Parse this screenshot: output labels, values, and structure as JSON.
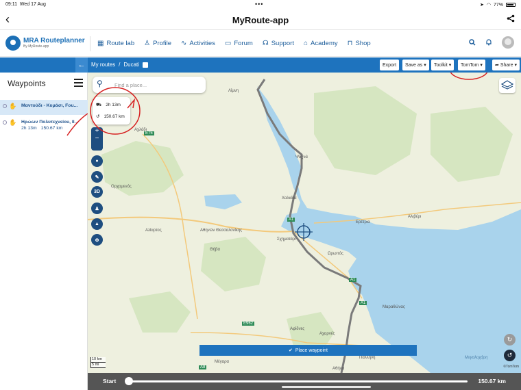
{
  "status_bar": {
    "time": "09:11",
    "date": "Wed 17 Aug",
    "battery": "77%"
  },
  "app": {
    "title": "MyRoute-app"
  },
  "site_nav": {
    "logo_title": "MRA Routeplanner",
    "logo_sub": "By MyRoute-app",
    "links": [
      {
        "label": "Route lab",
        "icon": "map-icon"
      },
      {
        "label": "Profile",
        "icon": "person-icon"
      },
      {
        "label": "Activities",
        "icon": "activity-icon"
      },
      {
        "label": "Forum",
        "icon": "chat-icon"
      },
      {
        "label": "Support",
        "icon": "headset-icon"
      },
      {
        "label": "Academy",
        "icon": "graduation-icon"
      },
      {
        "label": "Shop",
        "icon": "bag-icon"
      }
    ]
  },
  "toolbar": {
    "breadcrumb_root": "My routes",
    "breadcrumb_sep": "/",
    "route_name": "Ducati",
    "export": "Export",
    "save_as": "Save as",
    "toolkit": "Toolkit",
    "tomtom": "TomTom",
    "share": "Share"
  },
  "waypoints_panel": {
    "title": "Waypoints",
    "items": [
      {
        "name": "Μαντούδι - Κυμάσι, Fou...",
        "selected": true
      },
      {
        "name": "Ηρώων Πολυτεχνείου, Il...",
        "time": "2h 13m",
        "distance": "150.67 km",
        "selected": false
      }
    ]
  },
  "map": {
    "search_placeholder": "Find a place...",
    "info_time": "2h 13m",
    "info_distance": "150.67 km",
    "place_waypoint": "Place waypoint",
    "scale_km": "10 km",
    "scale_mi": "5 mi",
    "copyright": "©TomTom",
    "btn_3d": "3D",
    "labels": {
      "limni": "Λίμνη",
      "achladi": "Αχλάδι",
      "orchomenos": "Ορχομενός",
      "psachna": "Ψαχνά",
      "chalkida": "Χαλκίδα",
      "eretria": "Ερέτρια",
      "aliveri": "Αλιβέρι",
      "aliartos": "Αλίαρτος",
      "athinon_thess": "Αθηνών Θεσσαλονίκης",
      "schimatari": "Σχηματάρι",
      "thiva": "Θήβα",
      "oropos": "Ωρωπός",
      "marathonas": "Μαραθώνας",
      "afidnes": "Αφίδνες",
      "acharnes": "Αχαρνές",
      "megara": "Μέγαρα",
      "pallini": "Παλλήνη",
      "athina": "Αθήνα",
      "megalochari": "Μεγαλοχάρη",
      "e75": "E75",
      "e962": "E962",
      "a1_1": "A1",
      "a1_2": "A1",
      "a1_3": "A1",
      "a8": "A8"
    }
  },
  "slider": {
    "start": "Start",
    "end": "150.67 km",
    "position": 0
  }
}
